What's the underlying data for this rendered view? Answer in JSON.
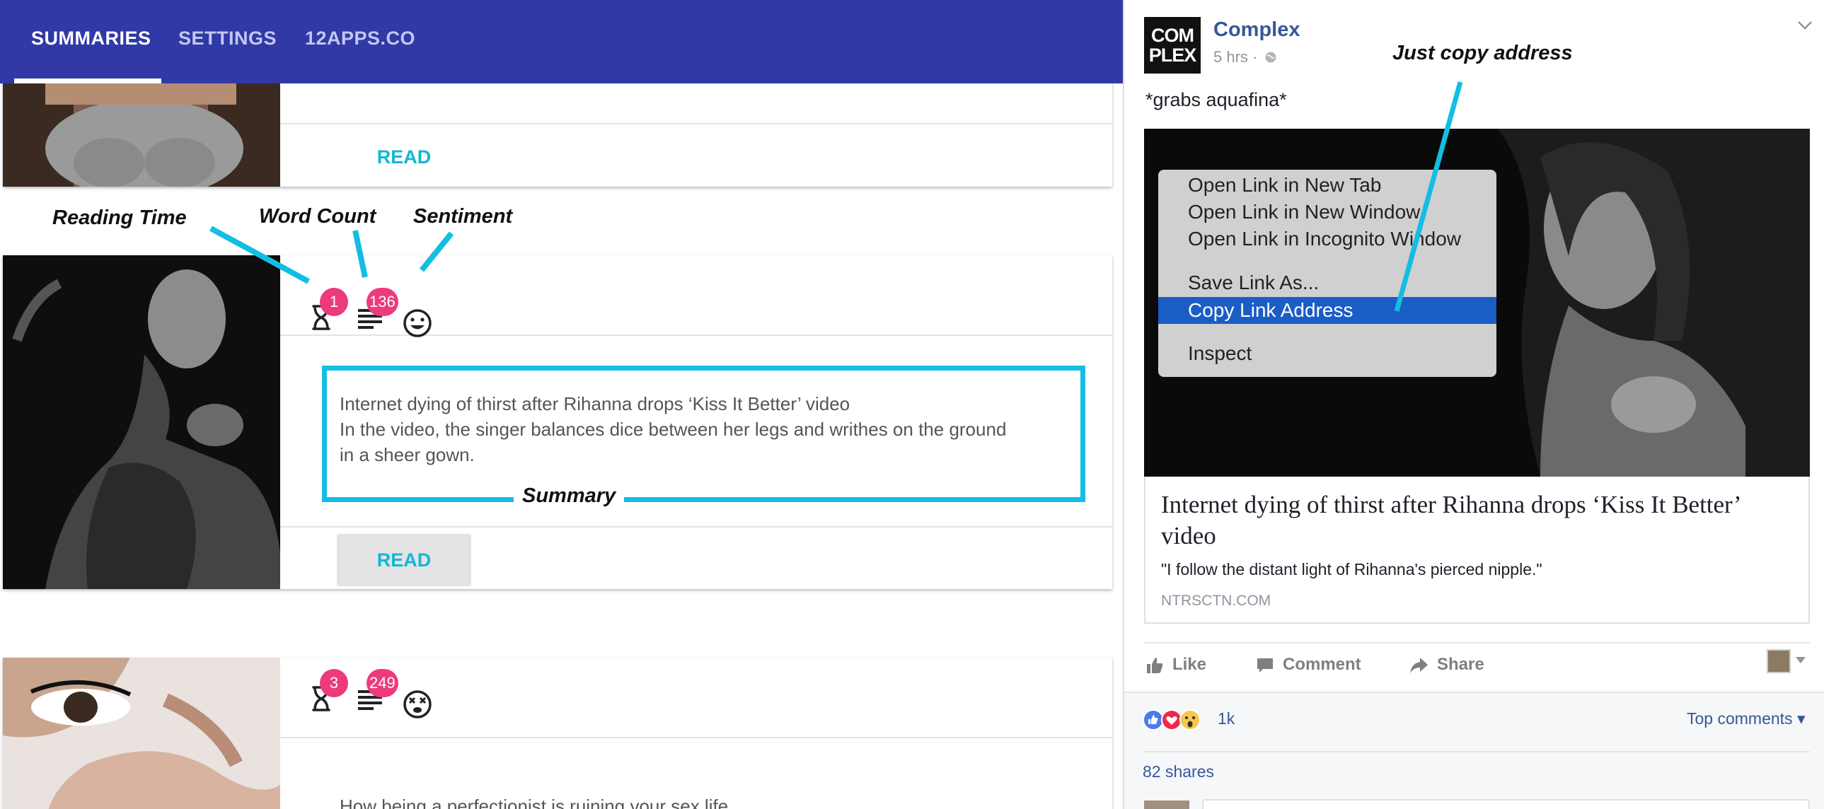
{
  "nav": {
    "tabs": [
      {
        "label": "SUMMARIES",
        "active": true
      },
      {
        "label": "SETTINGS",
        "active": false
      },
      {
        "label": "12APPS.CO",
        "active": false
      }
    ]
  },
  "cards": [
    {
      "read_label": "READ"
    },
    {
      "reading_time": "1",
      "word_count": "136",
      "sentiment_icon": "smile-face-icon",
      "summary_title": "Internet dying of thirst after Rihanna drops ‘Kiss It Better’ video",
      "summary_line_1": "In the video, the singer balances dice between her legs and writhes on the ground",
      "summary_line_2": "in a sheer gown.",
      "read_label": "READ"
    },
    {
      "reading_time": "3",
      "word_count": "249",
      "sentiment_icon": "dizzy-face-icon",
      "summary_title": "How being a perfectionist is ruining your sex life"
    }
  ],
  "annotations": {
    "reading_time": "Reading Time",
    "word_count": "Word Count",
    "sentiment": "Sentiment",
    "summary": "Summary",
    "copy_address": "Just copy address"
  },
  "post": {
    "page_name": "Complex",
    "logo_line_1": "COM",
    "logo_line_2": "PLEX",
    "time": "5 hrs ·",
    "caption": "*grabs aquafina*",
    "context_menu": {
      "items": [
        "Open Link in New Tab",
        "Open Link in New Window",
        "Open Link in Incognito Window",
        "Save Link As...",
        "Copy Link Address",
        "Inspect"
      ],
      "highlighted": "Copy Link Address"
    },
    "link_title": "Internet dying of thirst after Rihanna drops ‘Kiss It Better’ video",
    "link_description": "\"I follow the distant light of Rihanna's pierced nipple.\"",
    "link_domain": "NTRSCTN.COM",
    "actions": {
      "like": "Like",
      "comment": "Comment",
      "share": "Share"
    },
    "reaction_count": "1k",
    "top_comments": "Top comments",
    "shares": "82 shares"
  },
  "colors": {
    "nav_bg": "#3039a5",
    "badge": "#ec3b7c",
    "read_button_text": "#13b6d4",
    "annotation_cyan": "#14bde2",
    "fb_blue": "#365899",
    "menu_highlight": "#1a5dc5"
  }
}
